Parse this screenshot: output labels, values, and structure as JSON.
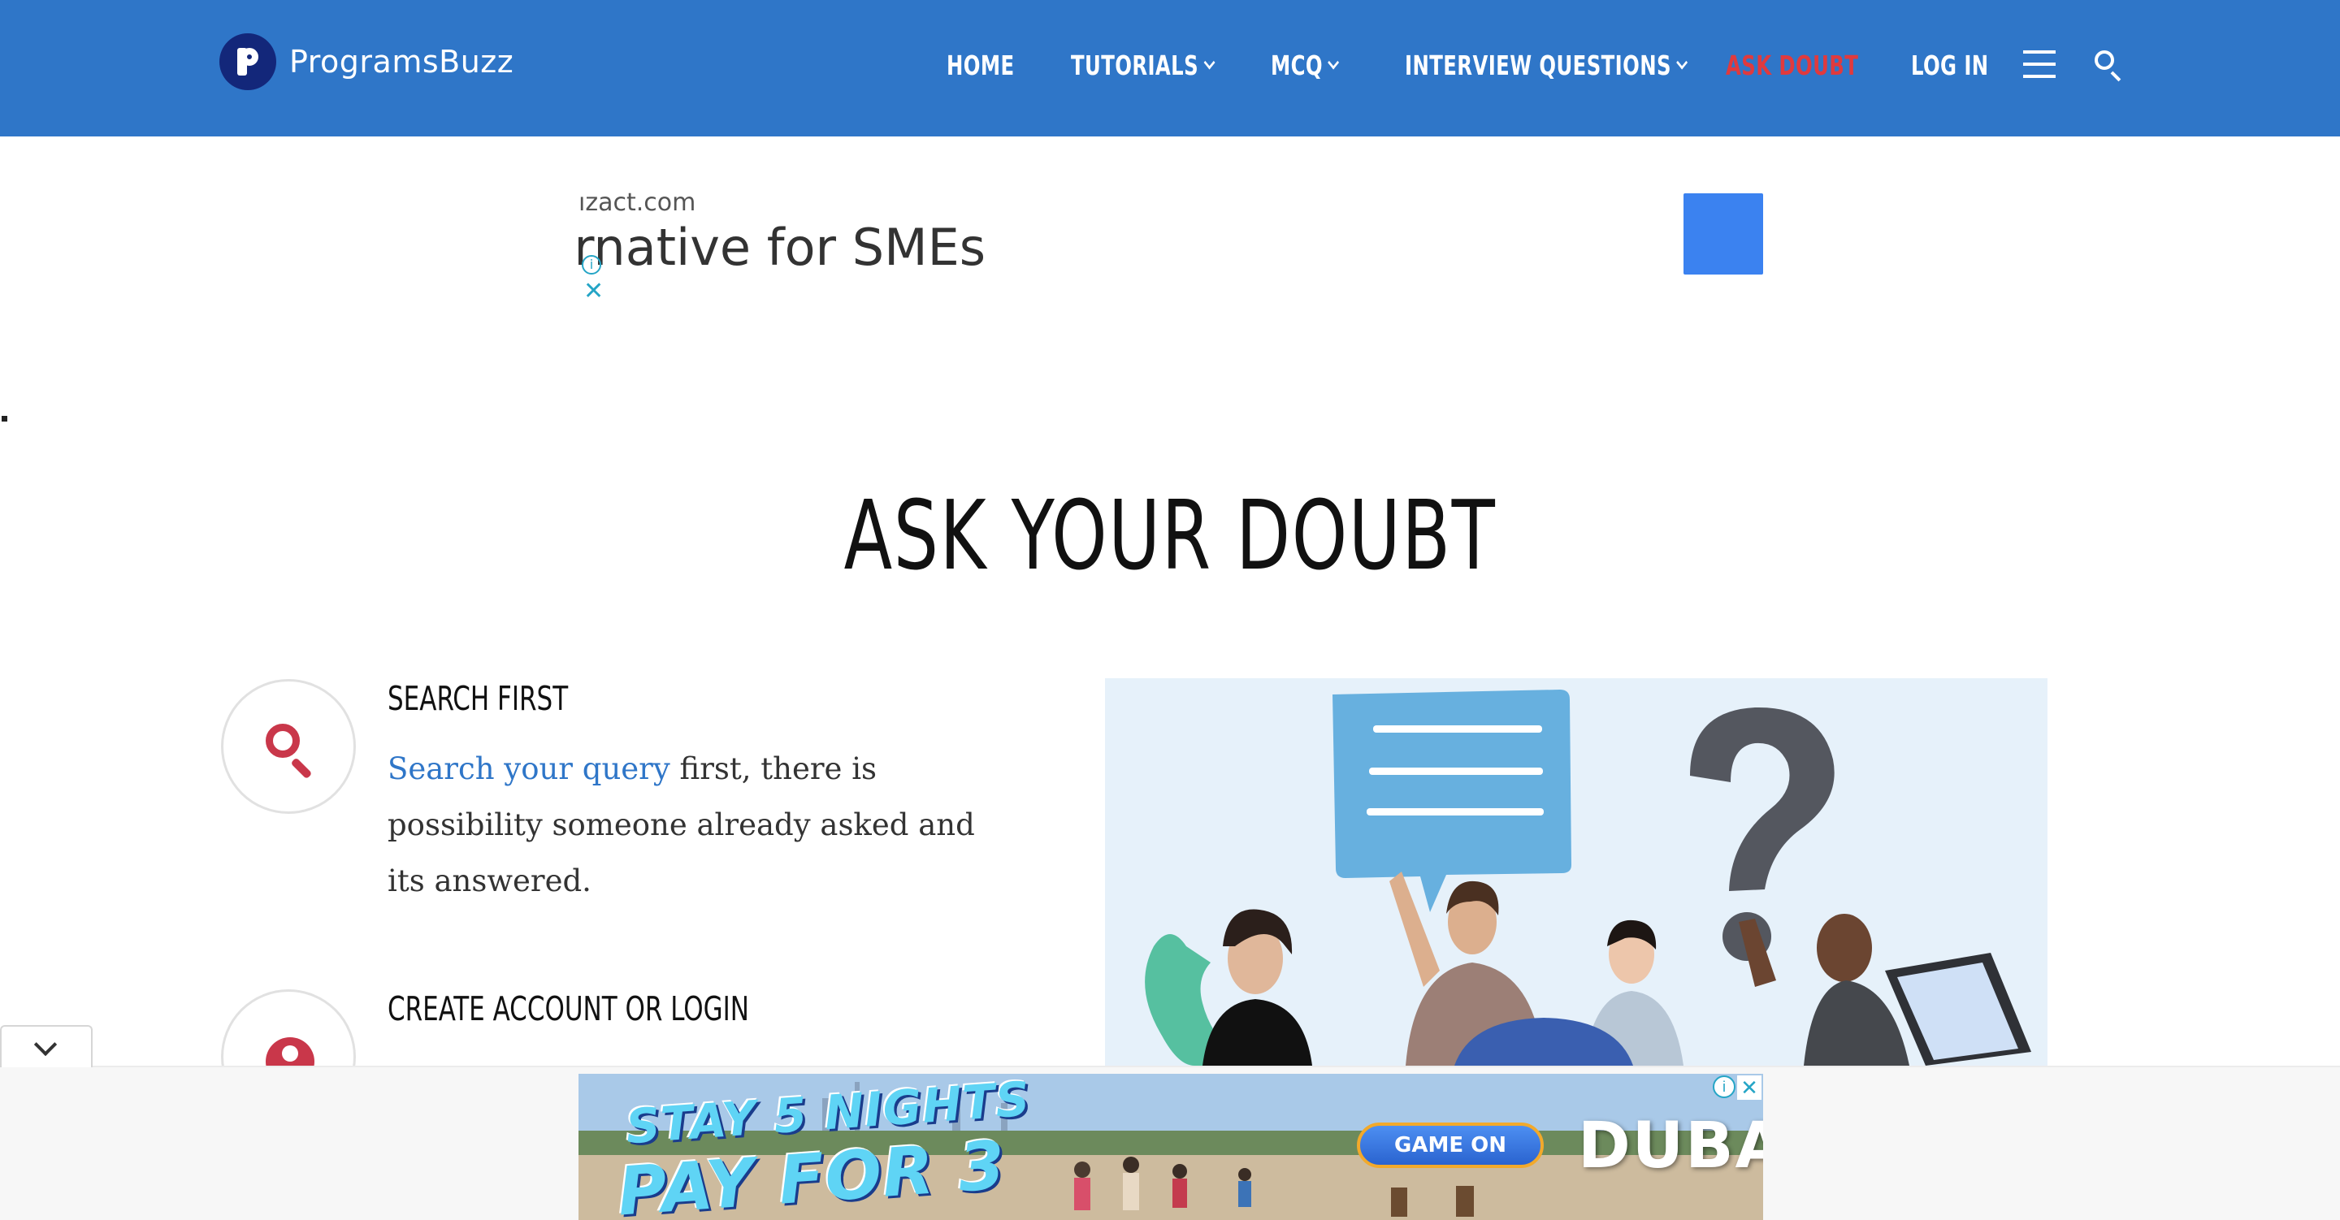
{
  "header": {
    "logo_text": "ProgramsBuzz",
    "nav": [
      {
        "label": "HOME",
        "dropdown": false,
        "active": false
      },
      {
        "label": "TUTORIALS",
        "dropdown": true,
        "active": false
      },
      {
        "label": "MCQ",
        "dropdown": true,
        "active": false
      },
      {
        "label": "INTERVIEW QUESTIONS",
        "dropdown": true,
        "active": false
      },
      {
        "label": "ASK DOUBT",
        "dropdown": false,
        "active": true
      },
      {
        "label": "LOG IN",
        "dropdown": false,
        "active": false
      }
    ],
    "icons": [
      "menu-icon",
      "search-icon"
    ],
    "bg_color": "#2f76c8",
    "active_color": "#e03a3e"
  },
  "ad_top": {
    "domain": "ızact.com",
    "headline": "rnative for SMEs",
    "info_glyph": "i",
    "close_glyph": "✕"
  },
  "main": {
    "title": "ASK YOUR DOUBT",
    "steps": [
      {
        "icon": "search-icon",
        "title": "SEARCH FIRST",
        "link_text": "Search your query",
        "text": " first, there is possibility someone already asked and its answered."
      },
      {
        "icon": "user-icon",
        "title": "CREATE ACCOUNT OR LOGIN"
      }
    ],
    "accent_color": "#c9374a",
    "link_color": "#2f76c8"
  },
  "ad_bottom": {
    "promo_line1": "STAY 5 NIGHTS",
    "promo_line2": "PAY FOR 3",
    "cta": "GAME ON",
    "brand": "DUBAI",
    "info_glyph": "i",
    "close_glyph": "✕"
  }
}
